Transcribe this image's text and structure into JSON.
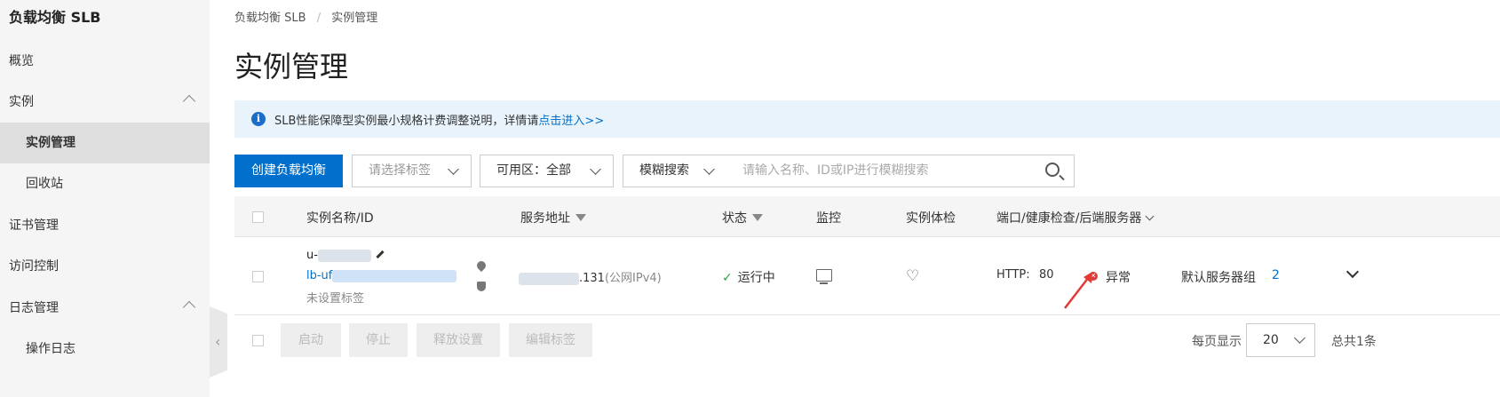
{
  "sidebar": {
    "title": "负载均衡 SLB",
    "items": [
      {
        "label": "概览"
      },
      {
        "label": "实例"
      },
      {
        "label": "实例管理"
      },
      {
        "label": "回收站"
      },
      {
        "label": "证书管理"
      },
      {
        "label": "访问控制"
      },
      {
        "label": "日志管理"
      },
      {
        "label": "操作日志"
      }
    ]
  },
  "breadcrumb": {
    "root": "负载均衡 SLB",
    "sep": "/",
    "current": "实例管理"
  },
  "page_title": "实例管理",
  "notice": {
    "text": "SLB性能保障型实例最小规格计费调整说明，详情请",
    "link": "点击进入>>"
  },
  "toolbar": {
    "create_label": "创建负载均衡",
    "tag_placeholder": "请选择标签",
    "zone_label": "可用区：",
    "zone_value": "全部",
    "search_mode": "模糊搜索",
    "search_placeholder": "请输入名称、ID或IP进行模糊搜索"
  },
  "table": {
    "headers": {
      "name": "实例名称/ID",
      "address": "服务地址",
      "status": "状态",
      "monitor": "监控",
      "check": "实例体检",
      "ports": "端口/健康检查/后端服务器"
    },
    "row": {
      "name_prefix": "u-",
      "id_prefix": "lb-uf",
      "tag": "未设置标签",
      "address_suffix": ".131",
      "address_type": "(公网IPv4)",
      "status": "运行中",
      "protocol": "HTTP:",
      "port": "80",
      "health": "异常",
      "server_group": "默认服务器组",
      "server_count": "2"
    }
  },
  "footer": {
    "start": "启动",
    "stop": "停止",
    "release": "释放设置",
    "edit_tags": "编辑标签",
    "page_size_label": "每页显示",
    "page_size": "20",
    "total": "总共1条"
  },
  "colors": {
    "primary": "#0070cc",
    "error": "#e03b3b",
    "success": "#2da14b",
    "annotation": "#e53935"
  }
}
